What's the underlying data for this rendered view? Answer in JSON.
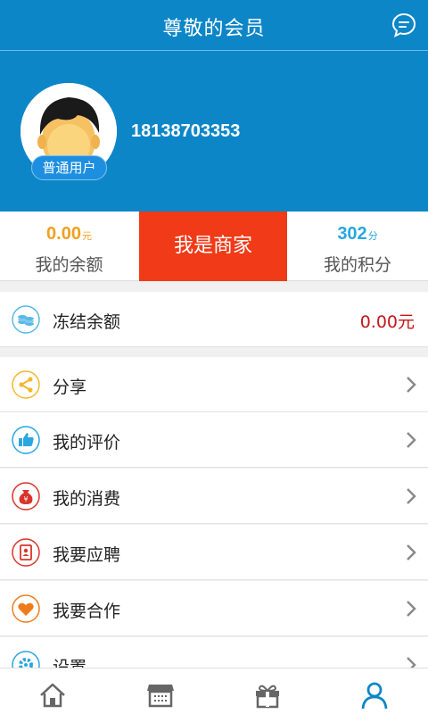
{
  "header": {
    "title": "尊敬的会员",
    "message_icon": "chat-bubble-icon"
  },
  "profile": {
    "level": "普通用户",
    "phone": "18138703353"
  },
  "stats": {
    "balance": {
      "value": "0.00",
      "unit": "元",
      "label": "我的余额"
    },
    "merchant_label": "我是商家",
    "points": {
      "value": "302",
      "unit": "分",
      "label": "我的积分"
    }
  },
  "frozen": {
    "label": "冻结余额",
    "value": "0.00元",
    "icon": "coins-icon"
  },
  "menu": [
    {
      "label": "分享",
      "icon": "share-icon"
    },
    {
      "label": "我的评价",
      "icon": "thumbs-up-icon"
    },
    {
      "label": "我的消费",
      "icon": "money-bag-icon"
    },
    {
      "label": "我要应聘",
      "icon": "resume-icon"
    },
    {
      "label": "我要合作",
      "icon": "heart-icon"
    },
    {
      "label": "设置",
      "icon": "gear-icon"
    }
  ],
  "tabbar": [
    {
      "name": "home",
      "icon": "home-icon",
      "active": false
    },
    {
      "name": "shop",
      "icon": "store-icon",
      "active": false
    },
    {
      "name": "gift",
      "icon": "gift-icon",
      "active": false
    },
    {
      "name": "me",
      "icon": "user-icon",
      "active": true
    }
  ],
  "colors": {
    "primary": "#0d86c8",
    "merchant": "#f03a18",
    "balance": "#f0a020",
    "points": "#2aa6e0",
    "frozen_value": "#c4161c"
  }
}
